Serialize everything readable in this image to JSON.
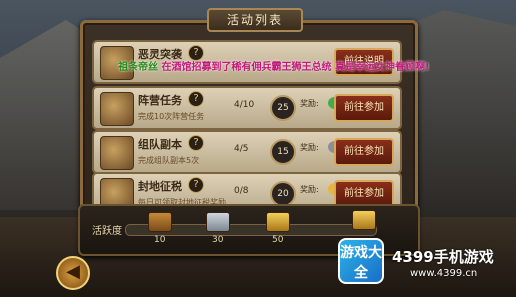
{
  "panel": {
    "title": "活动列表"
  },
  "overlay": {
    "part1": "祖条帝丝",
    "part2": "在酒馆招募到了稀有佣兵霸王狮王总统 真是幸运女神眷顾啊!"
  },
  "rows": [
    {
      "name": "恶灵突袭",
      "desc": "",
      "progress": "",
      "points": "",
      "reward_label": "",
      "button": "前往说明"
    },
    {
      "name": "阵营任务",
      "desc": "完成10次阵营任务",
      "progress": "4/10",
      "points": "25",
      "reward_label": "奖励:",
      "button": "前往参加"
    },
    {
      "name": "组队副本",
      "desc": "完成组队副本5次",
      "progress": "4/5",
      "points": "15",
      "reward_label": "奖励:",
      "button": "前往参加"
    },
    {
      "name": "封地征税",
      "desc": "每日可领取封地征税奖励",
      "progress": "0/8",
      "points": "20",
      "reward_label": "奖励:",
      "button": "前往参加"
    }
  ],
  "activity": {
    "label": "活跃度",
    "ticks": [
      "10",
      "30",
      "50"
    ]
  },
  "watermark": {
    "badge": "游戏大全",
    "brand": "4399手机游戏",
    "url": "www.4399.cn"
  },
  "colors": {
    "accent": "#d8a85a",
    "button": "#8a2e1a"
  }
}
